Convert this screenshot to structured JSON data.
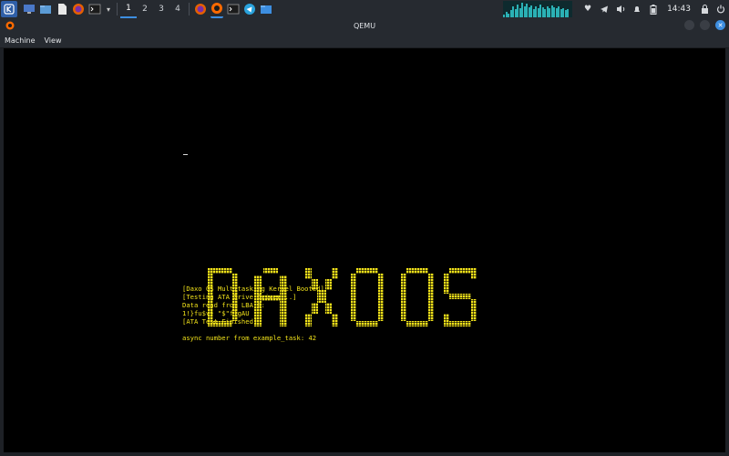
{
  "taskbar": {
    "workspaces": [
      "1",
      "2",
      "3",
      "4"
    ],
    "active_workspace": "1",
    "clock": "14:43",
    "launcher_icon": "kde-launcher-icon",
    "tray_icons": [
      "shield-icon",
      "telegram-icon",
      "volume-icon",
      "bell-icon",
      "battery-icon",
      "lock-icon",
      "power-icon"
    ]
  },
  "window": {
    "title": "QEMU"
  },
  "menubar": {
    "items": [
      "Machine",
      "View"
    ]
  },
  "vm_screen": {
    "logo_text": "DAXOOS",
    "console_lines": [
      "[Daxo OS Multitasking Kernel Booted]",
      "[Testing ATA Drive Driver...]",
      "Data read from LBA 0:",
      "1!}fu$v} \"$\"f}gAU",
      "[ATA Test Finished]",
      "",
      "async number from example_task: 42"
    ]
  },
  "colors": {
    "terminal_yellow": "#f0e11a",
    "taskbar_bg": "#262a30",
    "accent_blue": "#3d8ee0"
  }
}
